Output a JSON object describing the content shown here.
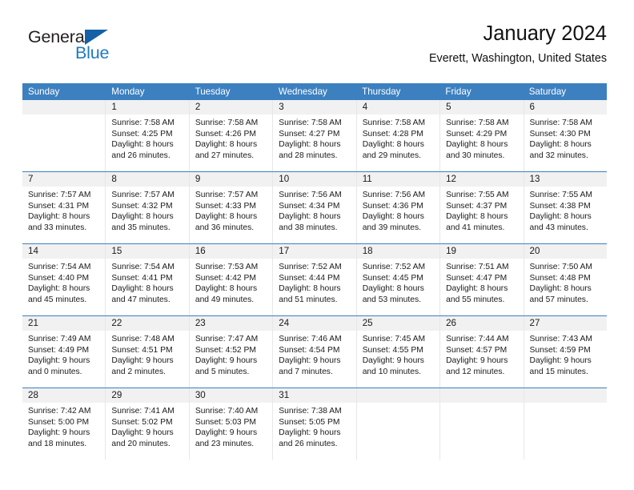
{
  "brand": {
    "name_top": "General",
    "name_bottom": "Blue",
    "accent_color": "#1461a8",
    "text_color": "#231f20"
  },
  "header": {
    "title": "January 2024",
    "subtitle": "Everett, Washington, United States"
  },
  "calendar": {
    "header_bg": "#3c80c0",
    "daynum_bg": "#f1f1f1",
    "weekdays": [
      "Sunday",
      "Monday",
      "Tuesday",
      "Wednesday",
      "Thursday",
      "Friday",
      "Saturday"
    ],
    "weeks": [
      [
        {
          "day": "",
          "lines": []
        },
        {
          "day": "1",
          "lines": [
            "Sunrise: 7:58 AM",
            "Sunset: 4:25 PM",
            "Daylight: 8 hours",
            "and 26 minutes."
          ]
        },
        {
          "day": "2",
          "lines": [
            "Sunrise: 7:58 AM",
            "Sunset: 4:26 PM",
            "Daylight: 8 hours",
            "and 27 minutes."
          ]
        },
        {
          "day": "3",
          "lines": [
            "Sunrise: 7:58 AM",
            "Sunset: 4:27 PM",
            "Daylight: 8 hours",
            "and 28 minutes."
          ]
        },
        {
          "day": "4",
          "lines": [
            "Sunrise: 7:58 AM",
            "Sunset: 4:28 PM",
            "Daylight: 8 hours",
            "and 29 minutes."
          ]
        },
        {
          "day": "5",
          "lines": [
            "Sunrise: 7:58 AM",
            "Sunset: 4:29 PM",
            "Daylight: 8 hours",
            "and 30 minutes."
          ]
        },
        {
          "day": "6",
          "lines": [
            "Sunrise: 7:58 AM",
            "Sunset: 4:30 PM",
            "Daylight: 8 hours",
            "and 32 minutes."
          ]
        }
      ],
      [
        {
          "day": "7",
          "lines": [
            "Sunrise: 7:57 AM",
            "Sunset: 4:31 PM",
            "Daylight: 8 hours",
            "and 33 minutes."
          ]
        },
        {
          "day": "8",
          "lines": [
            "Sunrise: 7:57 AM",
            "Sunset: 4:32 PM",
            "Daylight: 8 hours",
            "and 35 minutes."
          ]
        },
        {
          "day": "9",
          "lines": [
            "Sunrise: 7:57 AM",
            "Sunset: 4:33 PM",
            "Daylight: 8 hours",
            "and 36 minutes."
          ]
        },
        {
          "day": "10",
          "lines": [
            "Sunrise: 7:56 AM",
            "Sunset: 4:34 PM",
            "Daylight: 8 hours",
            "and 38 minutes."
          ]
        },
        {
          "day": "11",
          "lines": [
            "Sunrise: 7:56 AM",
            "Sunset: 4:36 PM",
            "Daylight: 8 hours",
            "and 39 minutes."
          ]
        },
        {
          "day": "12",
          "lines": [
            "Sunrise: 7:55 AM",
            "Sunset: 4:37 PM",
            "Daylight: 8 hours",
            "and 41 minutes."
          ]
        },
        {
          "day": "13",
          "lines": [
            "Sunrise: 7:55 AM",
            "Sunset: 4:38 PM",
            "Daylight: 8 hours",
            "and 43 minutes."
          ]
        }
      ],
      [
        {
          "day": "14",
          "lines": [
            "Sunrise: 7:54 AM",
            "Sunset: 4:40 PM",
            "Daylight: 8 hours",
            "and 45 minutes."
          ]
        },
        {
          "day": "15",
          "lines": [
            "Sunrise: 7:54 AM",
            "Sunset: 4:41 PM",
            "Daylight: 8 hours",
            "and 47 minutes."
          ]
        },
        {
          "day": "16",
          "lines": [
            "Sunrise: 7:53 AM",
            "Sunset: 4:42 PM",
            "Daylight: 8 hours",
            "and 49 minutes."
          ]
        },
        {
          "day": "17",
          "lines": [
            "Sunrise: 7:52 AM",
            "Sunset: 4:44 PM",
            "Daylight: 8 hours",
            "and 51 minutes."
          ]
        },
        {
          "day": "18",
          "lines": [
            "Sunrise: 7:52 AM",
            "Sunset: 4:45 PM",
            "Daylight: 8 hours",
            "and 53 minutes."
          ]
        },
        {
          "day": "19",
          "lines": [
            "Sunrise: 7:51 AM",
            "Sunset: 4:47 PM",
            "Daylight: 8 hours",
            "and 55 minutes."
          ]
        },
        {
          "day": "20",
          "lines": [
            "Sunrise: 7:50 AM",
            "Sunset: 4:48 PM",
            "Daylight: 8 hours",
            "and 57 minutes."
          ]
        }
      ],
      [
        {
          "day": "21",
          "lines": [
            "Sunrise: 7:49 AM",
            "Sunset: 4:49 PM",
            "Daylight: 9 hours",
            "and 0 minutes."
          ]
        },
        {
          "day": "22",
          "lines": [
            "Sunrise: 7:48 AM",
            "Sunset: 4:51 PM",
            "Daylight: 9 hours",
            "and 2 minutes."
          ]
        },
        {
          "day": "23",
          "lines": [
            "Sunrise: 7:47 AM",
            "Sunset: 4:52 PM",
            "Daylight: 9 hours",
            "and 5 minutes."
          ]
        },
        {
          "day": "24",
          "lines": [
            "Sunrise: 7:46 AM",
            "Sunset: 4:54 PM",
            "Daylight: 9 hours",
            "and 7 minutes."
          ]
        },
        {
          "day": "25",
          "lines": [
            "Sunrise: 7:45 AM",
            "Sunset: 4:55 PM",
            "Daylight: 9 hours",
            "and 10 minutes."
          ]
        },
        {
          "day": "26",
          "lines": [
            "Sunrise: 7:44 AM",
            "Sunset: 4:57 PM",
            "Daylight: 9 hours",
            "and 12 minutes."
          ]
        },
        {
          "day": "27",
          "lines": [
            "Sunrise: 7:43 AM",
            "Sunset: 4:59 PM",
            "Daylight: 9 hours",
            "and 15 minutes."
          ]
        }
      ],
      [
        {
          "day": "28",
          "lines": [
            "Sunrise: 7:42 AM",
            "Sunset: 5:00 PM",
            "Daylight: 9 hours",
            "and 18 minutes."
          ]
        },
        {
          "day": "29",
          "lines": [
            "Sunrise: 7:41 AM",
            "Sunset: 5:02 PM",
            "Daylight: 9 hours",
            "and 20 minutes."
          ]
        },
        {
          "day": "30",
          "lines": [
            "Sunrise: 7:40 AM",
            "Sunset: 5:03 PM",
            "Daylight: 9 hours",
            "and 23 minutes."
          ]
        },
        {
          "day": "31",
          "lines": [
            "Sunrise: 7:38 AM",
            "Sunset: 5:05 PM",
            "Daylight: 9 hours",
            "and 26 minutes."
          ]
        },
        {
          "day": "",
          "lines": []
        },
        {
          "day": "",
          "lines": []
        },
        {
          "day": "",
          "lines": []
        }
      ]
    ]
  }
}
